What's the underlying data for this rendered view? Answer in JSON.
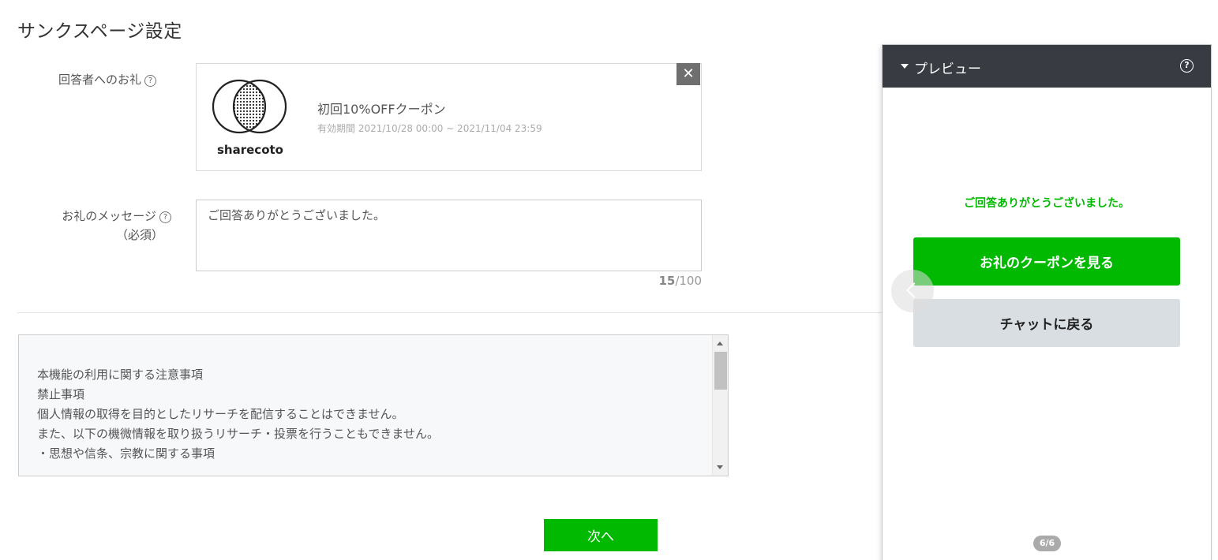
{
  "page": {
    "title": "サンクスページ設定"
  },
  "reward": {
    "label": "回答者へのお礼",
    "help": "?",
    "coupon": {
      "logo_text": "sharecoto",
      "title": "初回10%OFFクーポン",
      "validity": "有効期間 2021/10/28 00:00 ~ 2021/11/04 23:59",
      "remove": "✕"
    }
  },
  "message": {
    "label": "お礼のメッセージ",
    "required": "（必須）",
    "help": "?",
    "value": "ご回答ありがとうございました。",
    "count": "15",
    "max": "/100"
  },
  "notice": {
    "lines": [
      "本機能の利用に関する注意事項",
      "",
      "禁止事項",
      "個人情報の取得を目的としたリサーチを配信することはできません。",
      "また、以下の機微情報を取り扱うリサーチ・投票を行うこともできません。",
      "・思想や信条、宗教に関する事項"
    ]
  },
  "footer": {
    "next_label": "次へ"
  },
  "preview": {
    "title": "プレビュー",
    "help": "?",
    "thanks_message": "ご回答ありがとうございました。",
    "coupon_button": "お礼のクーポンを見る",
    "back_button": "チャットに戻る",
    "page_indicator": "6/6"
  },
  "colors": {
    "accent": "#00b900",
    "header": "#383c42"
  }
}
